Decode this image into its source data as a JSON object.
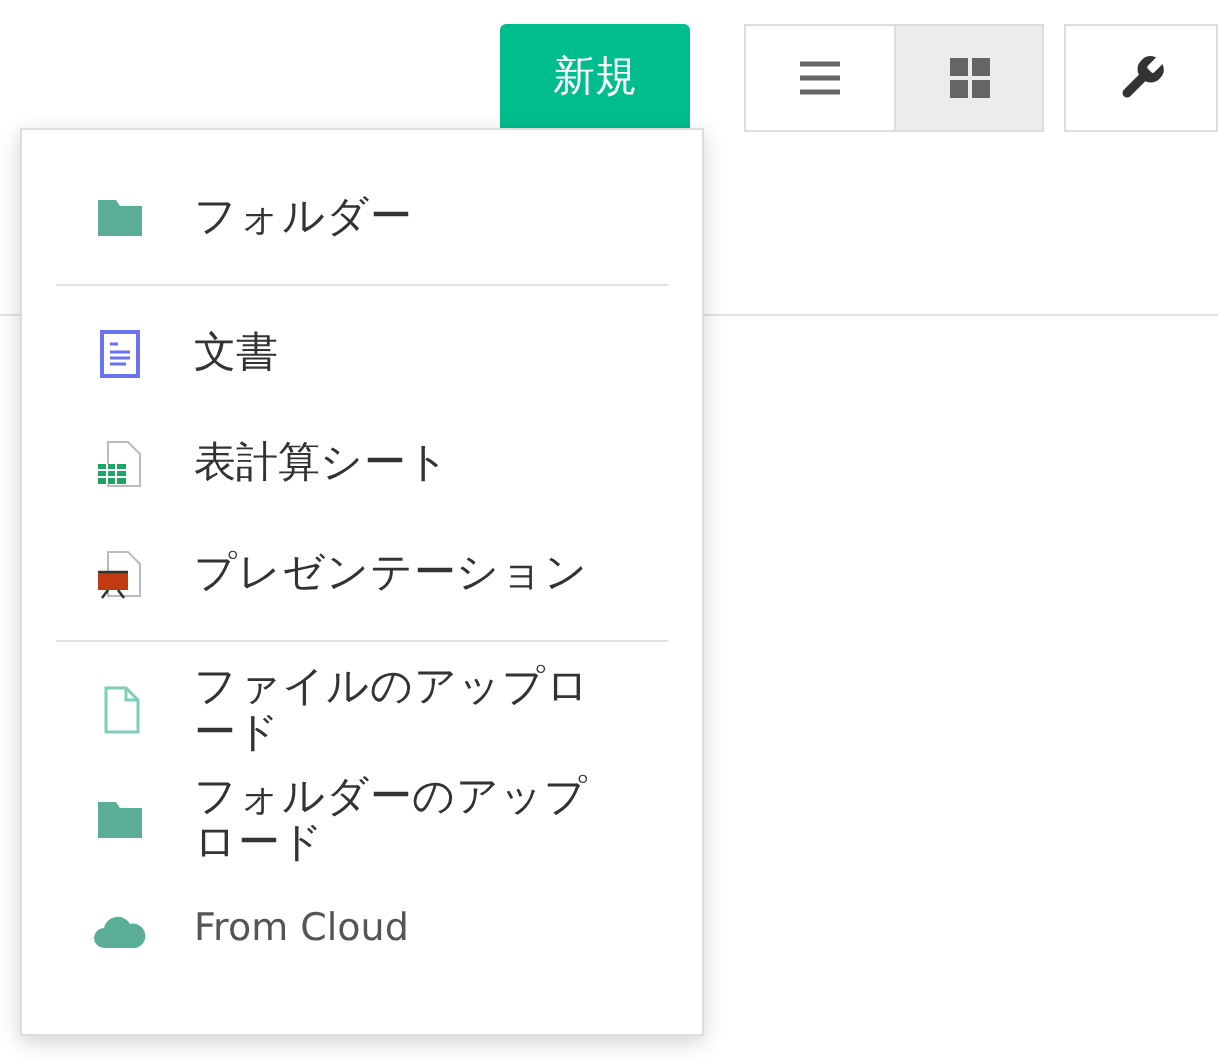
{
  "new_button": {
    "label": "新規"
  },
  "view_toggle": [
    {
      "kind": "list",
      "selected": false
    },
    {
      "kind": "grid",
      "selected": true
    }
  ],
  "new_menu": {
    "sections": [
      [
        {
          "kind": "folder",
          "label": "フォルダー"
        }
      ],
      [
        {
          "kind": "document",
          "label": "文書"
        },
        {
          "kind": "spreadsheet",
          "label": "表計算シート"
        },
        {
          "kind": "presentation",
          "label": "プレゼンテーション"
        }
      ],
      [
        {
          "kind": "file",
          "label": "ファイルのアップロード"
        },
        {
          "kind": "folder",
          "label": "フォルダーのアップロード"
        },
        {
          "kind": "cloud",
          "label": "From Cloud"
        }
      ]
    ]
  }
}
